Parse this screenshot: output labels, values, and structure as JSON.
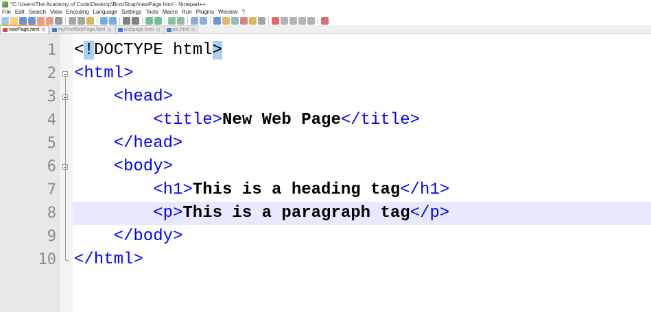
{
  "window": {
    "title": "*C:\\Users\\The Academy of Code\\Desktop\\BootStrap\\newPage.html - Notepad++"
  },
  "menu": [
    "File",
    "Edit",
    "Search",
    "View",
    "Encoding",
    "Language",
    "Settings",
    "Tools",
    "Macro",
    "Run",
    "Plugins",
    "Window",
    "?"
  ],
  "tabs": [
    {
      "label": "newPage.html",
      "active": true
    },
    {
      "label": "myFirstWebPage.html",
      "active": false
    },
    {
      "label": "webpage.html",
      "active": false
    },
    {
      "label": "pic.html",
      "active": false
    }
  ],
  "editor": {
    "current_line": 8,
    "lines": [
      {
        "num": "1",
        "indent": "",
        "parts": [
          {
            "t": "<",
            "k": "doc"
          },
          {
            "t": "!",
            "k": "hl"
          },
          {
            "t": "DOCTYPE html",
            "k": "doc"
          },
          {
            "t": ">",
            "k": "hl"
          }
        ]
      },
      {
        "num": "2",
        "indent": "",
        "parts": [
          {
            "t": "<html>",
            "k": "tag"
          }
        ]
      },
      {
        "num": "3",
        "indent": "    ",
        "parts": [
          {
            "t": "<head>",
            "k": "tag"
          }
        ]
      },
      {
        "num": "4",
        "indent": "        ",
        "parts": [
          {
            "t": "<title>",
            "k": "tag"
          },
          {
            "t": "New Web Page",
            "k": "text"
          },
          {
            "t": "</title>",
            "k": "tag"
          }
        ]
      },
      {
        "num": "5",
        "indent": "    ",
        "parts": [
          {
            "t": "</head>",
            "k": "tag"
          }
        ]
      },
      {
        "num": "6",
        "indent": "    ",
        "parts": [
          {
            "t": "<body>",
            "k": "tag"
          }
        ]
      },
      {
        "num": "7",
        "indent": "        ",
        "parts": [
          {
            "t": "<h1>",
            "k": "tag"
          },
          {
            "t": "This is a heading tag",
            "k": "text"
          },
          {
            "t": "</h1>",
            "k": "tag"
          }
        ]
      },
      {
        "num": "8",
        "indent": "        ",
        "parts": [
          {
            "t": "<p>",
            "k": "tag"
          },
          {
            "t": "This is a paragraph tag",
            "k": "text"
          },
          {
            "t": "</p>",
            "k": "tag"
          }
        ]
      },
      {
        "num": "9",
        "indent": "    ",
        "parts": [
          {
            "t": "</body>",
            "k": "tag"
          }
        ]
      },
      {
        "num": "10",
        "indent": "",
        "parts": [
          {
            "t": "</html>",
            "k": "tag"
          }
        ]
      }
    ]
  },
  "colors": {
    "tag": "#0000ff",
    "text": "#000000",
    "current_line": "#e8e8ff",
    "gutter": "#e8e8e8",
    "active_tab_accent": "#f7a23b"
  }
}
